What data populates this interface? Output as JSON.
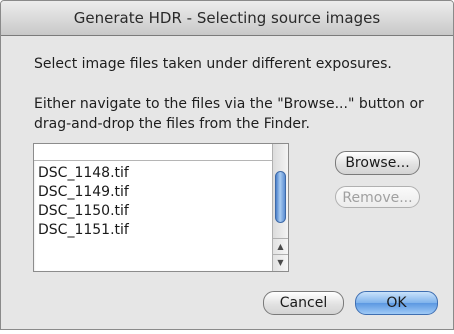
{
  "window": {
    "title": "Generate HDR - Selecting source images"
  },
  "instructions": {
    "line1": "Select image files taken under different exposures.",
    "line2": "Either navigate to the files via the \"Browse...\" button or drag-and-drop the files from the Finder."
  },
  "file_list": {
    "items": [
      "DSC_1148.tif",
      "DSC_1149.tif",
      "DSC_1150.tif",
      "DSC_1151.tif"
    ]
  },
  "buttons": {
    "browse": "Browse...",
    "remove": "Remove...",
    "cancel": "Cancel",
    "ok": "OK"
  },
  "icons": {
    "scroll_up": "arrow-up",
    "scroll_down": "arrow-down"
  },
  "colors": {
    "default_button": "#7fb3ec",
    "scroll_thumb": "#4a7fc9"
  }
}
